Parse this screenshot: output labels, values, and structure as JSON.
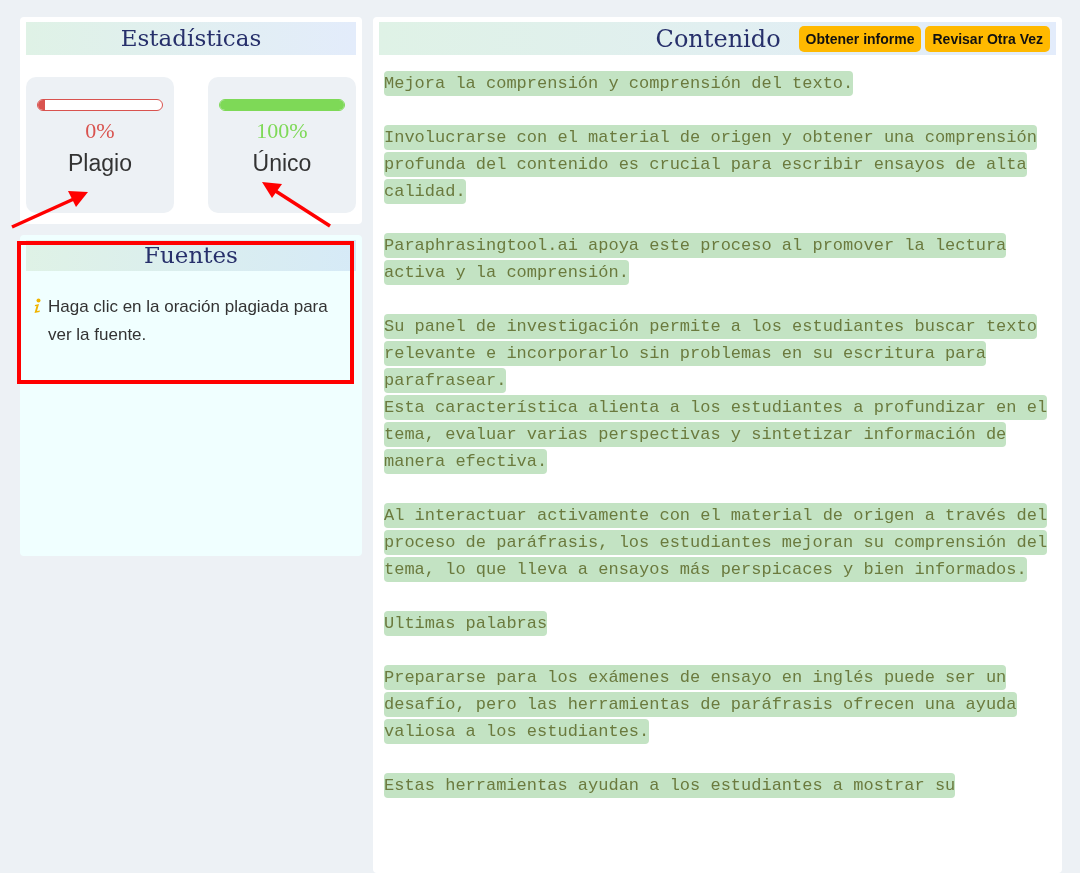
{
  "stats_panel": {
    "title": "Estadísticas",
    "stats": [
      {
        "label": "Plagio",
        "value": "0%",
        "level": 0,
        "color": "#d9534f"
      },
      {
        "label": "Único",
        "value": "100%",
        "level": 1,
        "color": "#7ed957"
      }
    ]
  },
  "sources_panel": {
    "title": "Fuentes",
    "hint": "Haga clic en la oración plagiada para ver la fuente."
  },
  "content_panel": {
    "title": "Contenido",
    "buttons": [
      "Obtener informe",
      "Revisar Otra Vez"
    ],
    "blocks": [
      [
        "Mejora la comprensión y comprensión del texto."
      ],
      [
        "Involucrarse con el material de origen y obtener una comprensión",
        "profunda del contenido es crucial para escribir ensayos de alta",
        "calidad."
      ],
      [
        "Paraphrasingtool.ai apoya este proceso al promover la lectura",
        "activa y la comprensión."
      ],
      [
        "Su panel de investigación permite a los estudiantes buscar texto",
        "relevante e incorporarlo sin problemas en su escritura para",
        "parafrasear.",
        "Esta característica alienta a los estudiantes a profundizar en el",
        "tema, evaluar varias perspectivas y sintetizar información de",
        "manera efectiva."
      ],
      [
        "Al interactuar activamente con el material de origen a través del",
        "proceso de paráfrasis, los estudiantes mejoran su comprensión del",
        "tema, lo que lleva a ensayos más perspicaces y bien informados."
      ],
      [
        "Ultimas palabras"
      ],
      [
        "Prepararse para los exámenes de ensayo en inglés puede ser un",
        "desafío, pero las herramientas de paráfrasis ofrecen una ayuda",
        "valiosa a los estudiantes."
      ],
      [
        "Estas herramientas ayudan a los estudiantes a mostrar su"
      ]
    ]
  }
}
